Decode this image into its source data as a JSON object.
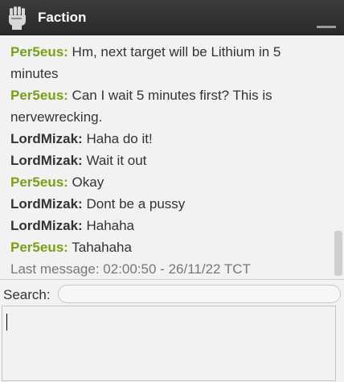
{
  "header": {
    "title": "Faction",
    "icon": "raised-fist-icon"
  },
  "colors": {
    "header_bg": "#2e2e2e",
    "self_name": "#78a018",
    "other_name": "#333333",
    "body_text": "#333333",
    "last_message": "#777777"
  },
  "messages": [
    {
      "sender": "Per5eus:",
      "text": " Hm, next target will be Lithium in 5 minutes",
      "self": true
    },
    {
      "sender": "Per5eus:",
      "text": " Can I wait 5 minutes first? This is nervewrecking.",
      "self": true
    },
    {
      "sender": "LordMizak:",
      "text": " Haha do it!",
      "self": false
    },
    {
      "sender": "LordMizak:",
      "text": " Wait it out",
      "self": false
    },
    {
      "sender": "Per5eus:",
      "text": " Okay",
      "self": true
    },
    {
      "sender": "LordMizak:",
      "text": " Dont be a pussy",
      "self": false
    },
    {
      "sender": "LordMizak:",
      "text": " Hahaha",
      "self": false
    },
    {
      "sender": "Per5eus:",
      "text": " Tahahaha",
      "self": true
    }
  ],
  "last_message": "Last message: 02:00:50 - 26/11/22 TCT",
  "search": {
    "label": "Search:",
    "value": ""
  },
  "compose": {
    "value": ""
  }
}
